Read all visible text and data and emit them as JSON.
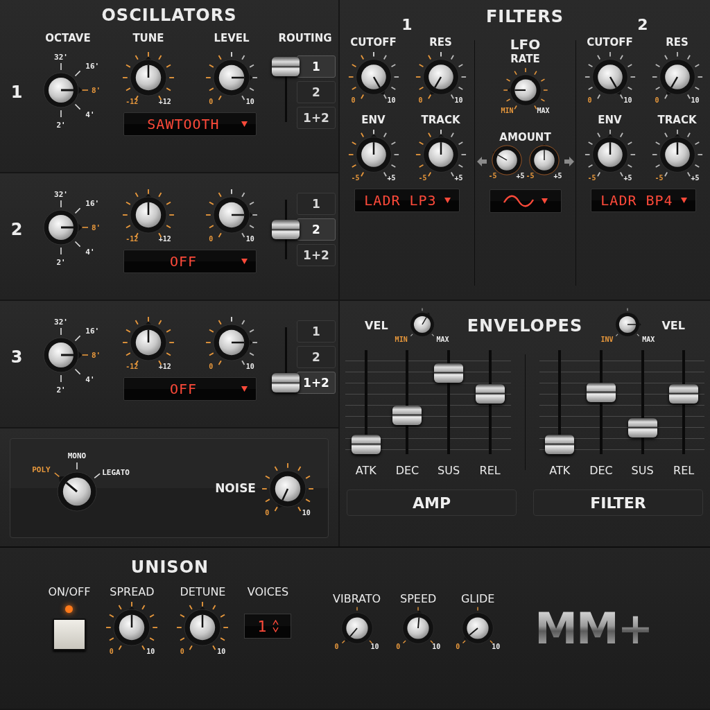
{
  "oscillators": {
    "title": "OSCILLATORS",
    "columns": [
      "OCTAVE",
      "TUNE",
      "LEVEL",
      "ROUTING"
    ],
    "rows": [
      {
        "number": "1",
        "octave": [
          {
            "label": "32'",
            "selected": false
          },
          {
            "label": "16'",
            "selected": false
          },
          {
            "label": "8'",
            "selected": true
          },
          {
            "label": "4'",
            "selected": false
          },
          {
            "label": "2'",
            "selected": false
          }
        ],
        "tune": {
          "min": "-12",
          "max": "+12"
        },
        "level": {
          "min": "0",
          "max": "10"
        },
        "waveform": "SAWTOOTH",
        "routing": [
          {
            "label": "1",
            "selected": true
          },
          {
            "label": "2",
            "selected": false
          },
          {
            "label": "1+2",
            "selected": false
          }
        ]
      },
      {
        "number": "2",
        "octave": [
          {
            "label": "32'",
            "selected": false
          },
          {
            "label": "16'",
            "selected": false
          },
          {
            "label": "8'",
            "selected": true
          },
          {
            "label": "4'",
            "selected": false
          },
          {
            "label": "2'",
            "selected": false
          }
        ],
        "tune": {
          "min": "-12",
          "max": "+12"
        },
        "level": {
          "min": "0",
          "max": "10"
        },
        "waveform": "OFF",
        "routing": [
          {
            "label": "1",
            "selected": false
          },
          {
            "label": "2",
            "selected": true
          },
          {
            "label": "1+2",
            "selected": false
          }
        ]
      },
      {
        "number": "3",
        "octave": [
          {
            "label": "32'",
            "selected": false
          },
          {
            "label": "16'",
            "selected": false
          },
          {
            "label": "8'",
            "selected": true
          },
          {
            "label": "4'",
            "selected": false
          },
          {
            "label": "2'",
            "selected": false
          }
        ],
        "tune": {
          "min": "-12",
          "max": "+12"
        },
        "level": {
          "min": "0",
          "max": "10"
        },
        "waveform": "OFF",
        "routing": [
          {
            "label": "1",
            "selected": false
          },
          {
            "label": "2",
            "selected": false
          },
          {
            "label": "1+2",
            "selected": true
          }
        ]
      }
    ]
  },
  "voice_mode": [
    {
      "label": "POLY",
      "selected": true
    },
    {
      "label": "MONO",
      "selected": false
    },
    {
      "label": "LEGATO",
      "selected": false
    }
  ],
  "noise": {
    "label": "NOISE",
    "min": "0",
    "max": "10"
  },
  "filters": {
    "title": "FILTERS",
    "units": [
      {
        "number": "1",
        "knobs": [
          {
            "label": "CUTOFF",
            "min": "0",
            "max": "10"
          },
          {
            "label": "RES",
            "min": "0",
            "max": "10"
          },
          {
            "label": "ENV",
            "min": "-5",
            "max": "+5"
          },
          {
            "label": "TRACK",
            "min": "-5",
            "max": "+5"
          }
        ],
        "type": "LADR LP3"
      },
      {
        "number": "2",
        "knobs": [
          {
            "label": "CUTOFF",
            "min": "0",
            "max": "10"
          },
          {
            "label": "RES",
            "min": "0",
            "max": "10"
          },
          {
            "label": "ENV",
            "min": "-5",
            "max": "+5"
          },
          {
            "label": "TRACK",
            "min": "-5",
            "max": "+5"
          }
        ],
        "type": "LADR BP4"
      }
    ],
    "lfo": {
      "title": "LFO",
      "rate": {
        "label": "RATE",
        "min": "MIN",
        "max": "MAX"
      },
      "amount_label": "AMOUNT",
      "amounts": [
        {
          "min": "-5",
          "max": "+5"
        },
        {
          "min": "-5",
          "max": "+5"
        }
      ]
    }
  },
  "envelopes": {
    "title": "ENVELOPES",
    "units": [
      {
        "name": "AMP",
        "velocity": {
          "label": "VEL",
          "min": "MIN",
          "max": "MAX"
        },
        "faders": [
          {
            "label": "ATK",
            "level": 0.0
          },
          {
            "label": "DEC",
            "level": 0.35
          },
          {
            "label": "SUS",
            "level": 0.85
          },
          {
            "label": "REL",
            "level": 0.6
          }
        ]
      },
      {
        "name": "FILTER",
        "velocity": {
          "label": "VEL",
          "min": "INV",
          "max": "MAX"
        },
        "faders": [
          {
            "label": "ATK",
            "level": 0.0
          },
          {
            "label": "DEC",
            "level": 0.62
          },
          {
            "label": "SUS",
            "level": 0.2
          },
          {
            "label": "REL",
            "level": 0.6
          }
        ]
      }
    ]
  },
  "unison": {
    "title": "UNISON",
    "switch": {
      "label": "ON/OFF",
      "on": true
    },
    "knobs": [
      {
        "label": "SPREAD",
        "min": "0",
        "max": "10"
      },
      {
        "label": "DETUNE",
        "min": "0",
        "max": "10"
      }
    ],
    "voices": {
      "label": "VOICES",
      "value": "1"
    }
  },
  "performance": [
    {
      "label": "VIBRATO",
      "min": "0",
      "max": "10"
    },
    {
      "label": "SPEED",
      "min": "0",
      "max": "10"
    },
    {
      "label": "GLIDE",
      "min": "0",
      "max": "10"
    }
  ],
  "logo": "MM+"
}
